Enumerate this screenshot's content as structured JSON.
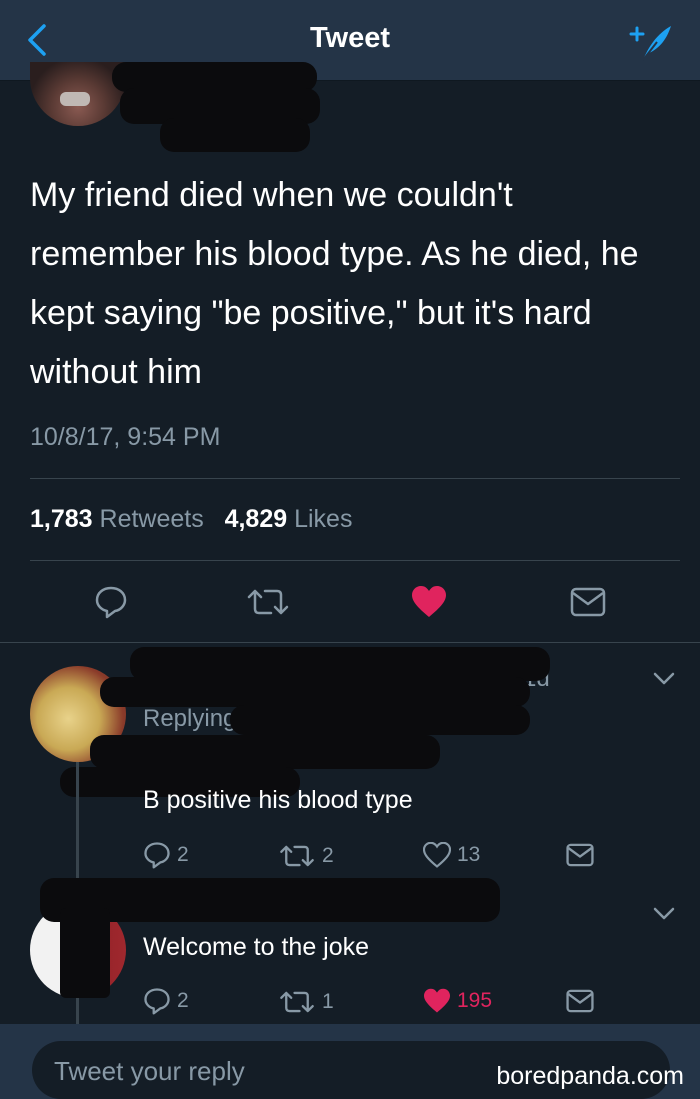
{
  "header": {
    "title": "Tweet",
    "back_icon": "back-chevron-icon",
    "compose_icon": "compose-tweet-icon",
    "accent": "#1da1f2",
    "background": "#243447"
  },
  "tweet": {
    "text": "My friend died when we couldn't remember his blood type. As he died, he kept saying \"be positive,\" but it's hard without him",
    "timestamp": "10/8/17, 9:54 PM",
    "retweets": "1,783",
    "retweets_label": "Retweets",
    "likes": "4,829",
    "likes_label": "Likes",
    "liked": true,
    "like_color": "#e0245e"
  },
  "replies": [
    {
      "meta": "·1d",
      "replying_to": "Replying to",
      "text": "B positive his blood type",
      "reply_count": "2",
      "retweet_count": "2",
      "like_count": "13",
      "liked": false
    },
    {
      "text": "Welcome to the joke",
      "reply_count": "2",
      "retweet_count": "1",
      "like_count": "195",
      "liked": true
    }
  ],
  "composer": {
    "placeholder": "Tweet your reply"
  },
  "watermark": "boredpanda.com"
}
